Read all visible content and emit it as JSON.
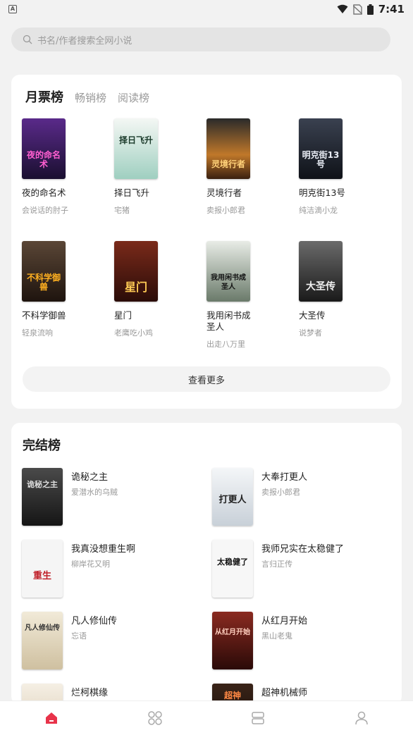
{
  "status_bar": {
    "time": "7:41",
    "app_badge": "A"
  },
  "search": {
    "placeholder": "书名/作者搜索全网小说"
  },
  "ranking_tabs": [
    {
      "label": "月票榜",
      "active": true
    },
    {
      "label": "畅销榜",
      "active": false
    },
    {
      "label": "阅读榜",
      "active": false
    }
  ],
  "ranking_books": [
    {
      "title": "夜的命名术",
      "author": "会说话的肘子",
      "cover_text": "夜的命名术",
      "cover_color": "#3a1f5c"
    },
    {
      "title": "择日飞升",
      "author": "宅猪",
      "cover_text": "择日飞升",
      "cover_color": "#cfe6dd"
    },
    {
      "title": "灵境行者",
      "author": "卖报小郎君",
      "cover_text": "灵境行者",
      "cover_color": "#7a4a1c"
    },
    {
      "title": "明克街13号",
      "author": "纯洁滴小龙",
      "cover_text": "明克街13号",
      "cover_color": "#1c2330"
    },
    {
      "title": "不科学御兽",
      "author": "轻泉流响",
      "cover_text": "不科学御兽",
      "cover_color": "#3b2a1e"
    },
    {
      "title": "星门",
      "author": "老鹰吃小鸡",
      "cover_text": "星门",
      "cover_color": "#4a1a12"
    },
    {
      "title": "我用闲书成圣人",
      "author": "出走八万里",
      "cover_text": "我用闲书成圣人",
      "cover_color": "#9aa79a"
    },
    {
      "title": "大圣传",
      "author": "说梦者",
      "cover_text": "大圣传",
      "cover_color": "#4a4a4a"
    }
  ],
  "more_button": {
    "label": "查看更多"
  },
  "completed": {
    "heading": "完结榜",
    "books": [
      {
        "title": "诡秘之主",
        "author": "爱潜水的乌贼",
        "cover_text": "诡秘之主",
        "cover_color": "#2b2b2b"
      },
      {
        "title": "大奉打更人",
        "author": "卖报小郎君",
        "cover_text": "打更人",
        "cover_color": "#eef0f2"
      },
      {
        "title": "我真没想重生啊",
        "author": "柳岸花又明",
        "cover_text": "重生",
        "cover_color": "#f5f5f5"
      },
      {
        "title": "我师兄实在太稳健了",
        "author": "言归正传",
        "cover_text": "太稳健了",
        "cover_color": "#f7f7f7"
      },
      {
        "title": "凡人修仙传",
        "author": "忘语",
        "cover_text": "凡人修仙传",
        "cover_color": "#e9dfc9"
      },
      {
        "title": "从红月开始",
        "author": "黑山老鬼",
        "cover_text": "从红月开始",
        "cover_color": "#5a1a14"
      },
      {
        "title": "烂柯棋缘",
        "author": "",
        "cover_text": "",
        "cover_color": "#efe8dc"
      },
      {
        "title": "超神机械师",
        "author": "",
        "cover_text": "超神",
        "cover_color": "#2a1a12"
      }
    ]
  },
  "bottom_nav": [
    {
      "icon": "home-icon",
      "active": true
    },
    {
      "icon": "category-icon",
      "active": false
    },
    {
      "icon": "bookshelf-icon",
      "active": false
    },
    {
      "icon": "profile-icon",
      "active": false
    }
  ],
  "colors": {
    "accent": "#e8334a",
    "background": "#f2f2f2",
    "card": "#ffffff"
  }
}
